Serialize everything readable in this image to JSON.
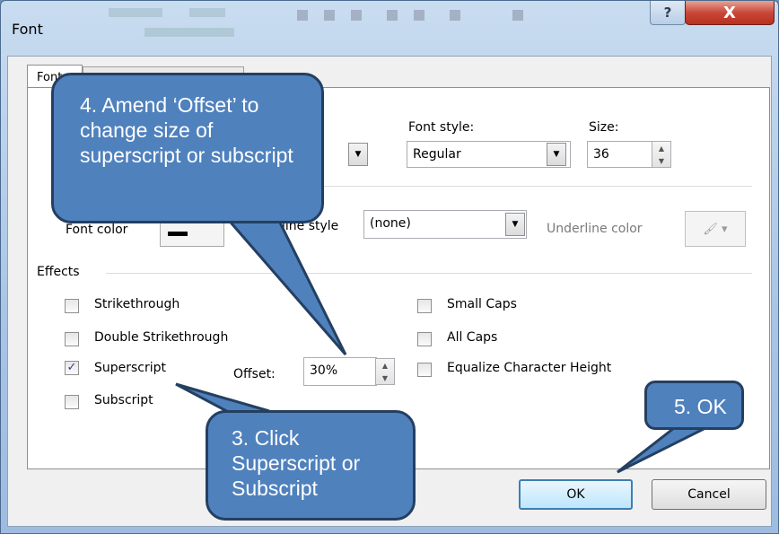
{
  "window": {
    "title": "Font",
    "help_glyph": "?",
    "close_glyph": "X"
  },
  "tabs": [
    {
      "label": "Font",
      "selected": true
    }
  ],
  "font": {
    "style_label": "Font style:",
    "style_value": "Regular",
    "size_label": "Size:",
    "size_value": "36"
  },
  "row2": {
    "font_color_label": "Font color",
    "underline_style_label": "line style",
    "underline_style_value": "(none)",
    "underline_color_label": "Underline color"
  },
  "effects": {
    "heading": "Effects",
    "left": [
      {
        "label": "Strikethrough",
        "checked": false
      },
      {
        "label": "Double Strikethrough",
        "checked": false
      },
      {
        "label": "Superscript",
        "checked": true
      },
      {
        "label": "Subscript",
        "checked": false
      }
    ],
    "right": [
      {
        "label": "Small Caps",
        "checked": false
      },
      {
        "label": "All Caps",
        "checked": false
      },
      {
        "label": "Equalize Character Height",
        "checked": false
      }
    ],
    "offset_label": "Offset:",
    "offset_value": "30%"
  },
  "buttons": {
    "ok": "OK",
    "cancel": "Cancel"
  },
  "callouts": {
    "offset": "4. Amend ‘Offset’ to change size of superscript or subscript",
    "superscript": "3. Click Superscript or Subscript",
    "ok": "5. OK"
  },
  "colors": {
    "callout_fill": "#4f81bd",
    "callout_border": "#243f60"
  }
}
